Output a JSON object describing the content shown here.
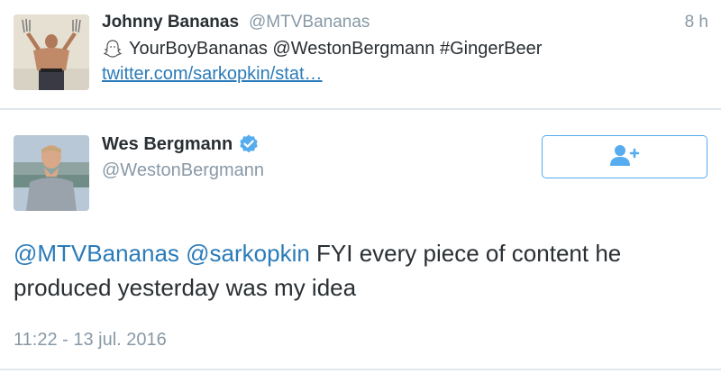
{
  "retweet_card": {
    "author_name": "Johnny Bananas",
    "author_handle": "@MTVBananas",
    "time_ago": "8 h",
    "text": "YourBoyBananas @WestonBergmann #GingerBeer",
    "link": "twitter.com/sarkopkin/stat…"
  },
  "main_tweet": {
    "author_name": "Wes Bergmann",
    "author_handle": "@WestonBergmann",
    "verified": true,
    "mention_1": "@MTVBananas",
    "mention_2": "@sarkopkin",
    "text": " FYI every piece of content he produced yesterday was my idea",
    "timestamp": "11:22 - 13 jul. 2016"
  },
  "colors": {
    "link_blue": "#2b7bb9",
    "verified_blue": "#55acee",
    "muted_gray": "#8899a6",
    "divider": "#e1e8ed"
  },
  "icons": {
    "follow_button": "add-user-icon",
    "verified_badge": "verified-icon",
    "snapchat_ghost": "ghost-icon"
  }
}
